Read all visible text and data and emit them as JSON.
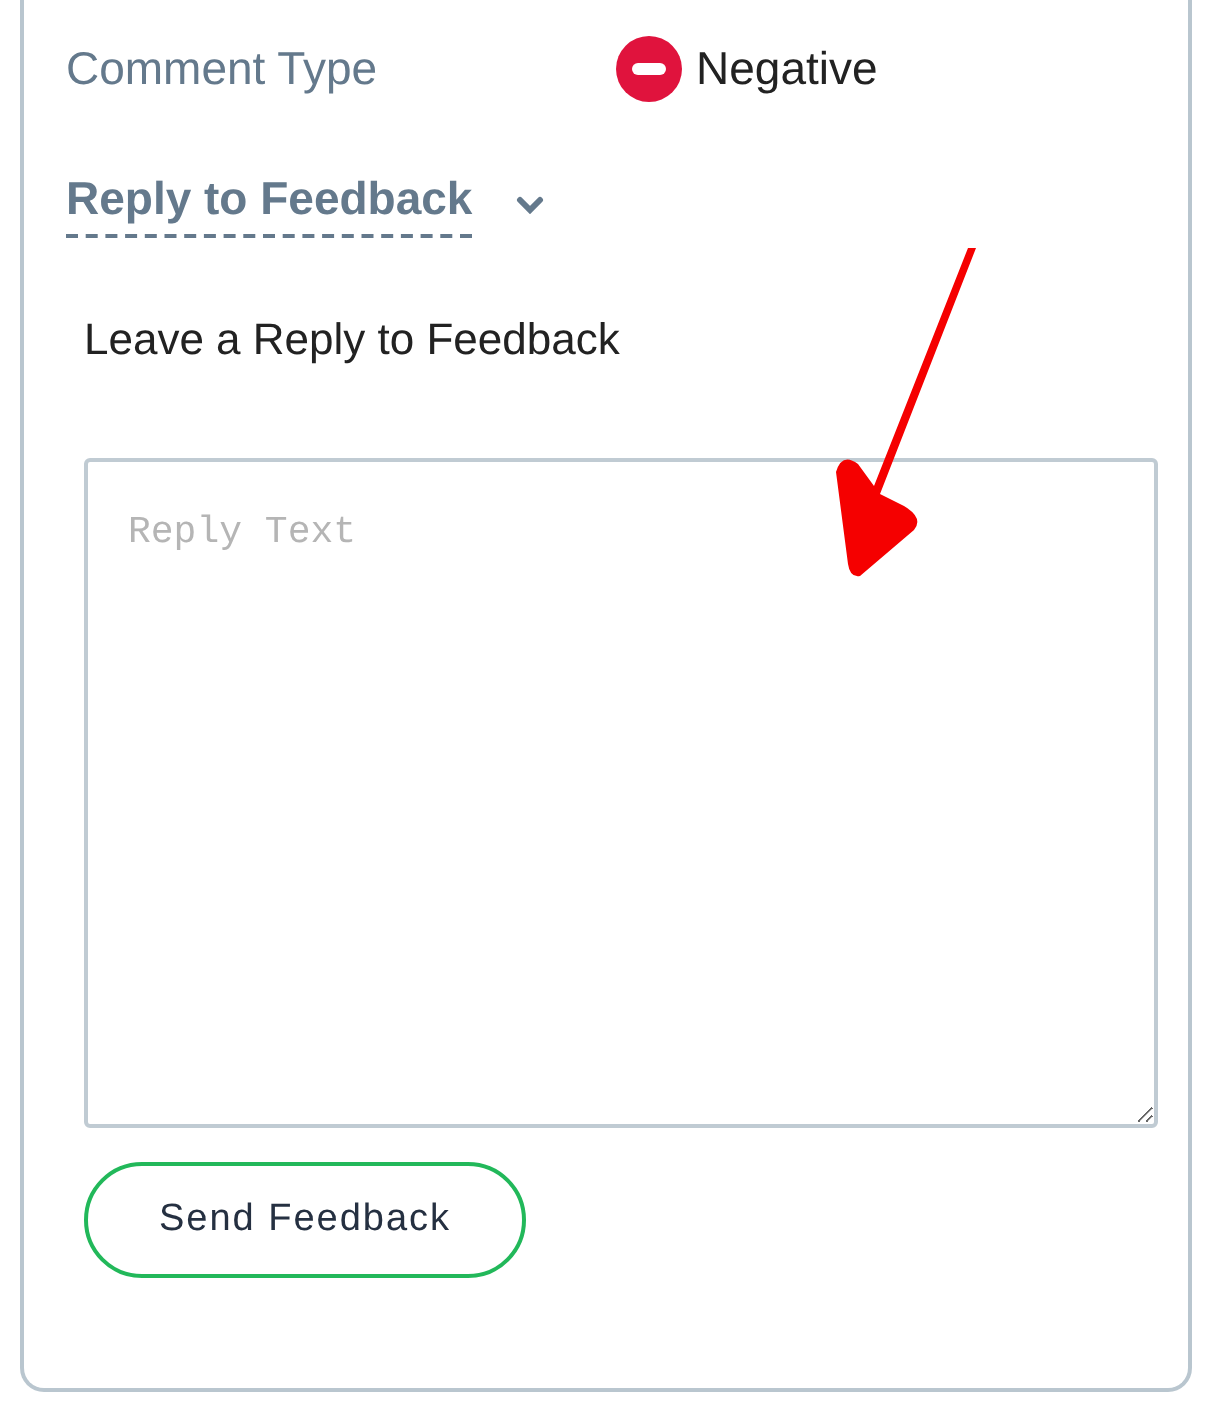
{
  "comment_type": {
    "label": "Comment Type",
    "value": "Negative",
    "kind": "negative"
  },
  "reply_section": {
    "title": "Reply to Feedback",
    "expanded": true,
    "heading": "Leave a Reply to Feedback",
    "reply_field": {
      "placeholder": "Reply Text"
    },
    "send_button": "Send Feedback"
  }
}
